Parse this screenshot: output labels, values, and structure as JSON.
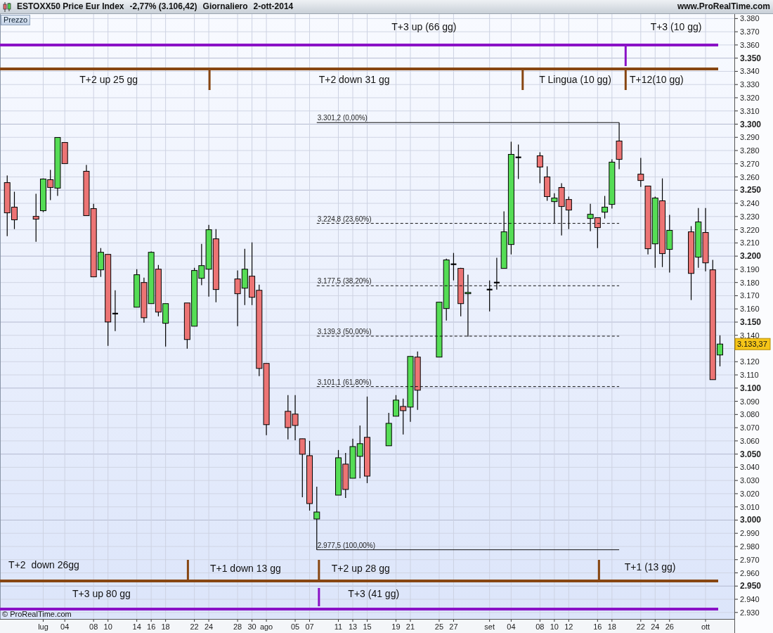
{
  "header": {
    "symbol": "ESTOXX50 Price Eur Index",
    "change": "-2,77% (3.106,42)",
    "period": "Giornaliero",
    "date": "2-ott-2014",
    "site": "www.ProRealTime.com"
  },
  "chart": {
    "pane_label": "Prezzo",
    "copyright": "© ProRealTime.com",
    "cycles": [
      {
        "color": "#8a12c6",
        "labels": [
          "T+3 up (66 gg)",
          "T+3 (10 gg)"
        ]
      },
      {
        "color": "#874612",
        "labels": [
          "T+2 up 25 gg",
          "T+2 down 31 gg",
          "T Lingua (10 gg)",
          "T+12(10 gg)"
        ]
      },
      {
        "color": "#874612",
        "labels": [
          "T+2  down 26gg",
          "T+1 down 13 gg",
          "T+2 up 28 gg",
          "T+1 (13 gg)"
        ]
      },
      {
        "color": "#8a12c6",
        "labels": [
          "T+3 up 80 gg",
          "T+3 (41 gg)"
        ]
      }
    ],
    "chart_data": {
      "type": "candlestick",
      "grid": true,
      "ylim": [
        2925.1,
        3383.4
      ],
      "xlim": [
        "2014-06-25",
        "2014-10-05"
      ],
      "x": [
        "2014-06-26",
        "2014-06-27",
        "2014-06-30",
        "2014-07-01",
        "2014-07-02",
        "2014-07-03",
        "2014-07-04",
        "2014-07-07",
        "2014-07-08",
        "2014-07-09",
        "2014-07-10",
        "2014-07-11",
        "2014-07-14",
        "2014-07-15",
        "2014-07-16",
        "2014-07-17",
        "2014-07-18",
        "2014-07-21",
        "2014-07-22",
        "2014-07-23",
        "2014-07-24",
        "2014-07-25",
        "2014-07-28",
        "2014-07-29",
        "2014-07-30",
        "2014-07-31",
        "2014-08-01",
        "2014-08-04",
        "2014-08-05",
        "2014-08-06",
        "2014-08-07",
        "2014-08-08",
        "2014-08-11",
        "2014-08-12",
        "2014-08-13",
        "2014-08-14",
        "2014-08-15",
        "2014-08-18",
        "2014-08-19",
        "2014-08-20",
        "2014-08-21",
        "2014-08-22",
        "2014-08-25",
        "2014-08-26",
        "2014-08-27",
        "2014-08-28",
        "2014-08-29",
        "2014-09-01",
        "2014-09-02",
        "2014-09-03",
        "2014-09-04",
        "2014-09-05",
        "2014-09-08",
        "2014-09-09",
        "2014-09-10",
        "2014-09-11",
        "2014-09-12",
        "2014-09-15",
        "2014-09-16",
        "2014-09-17",
        "2014-09-18",
        "2014-09-19",
        "2014-09-22",
        "2014-09-23",
        "2014-09-24",
        "2014-09-25",
        "2014-09-26",
        "2014-09-29",
        "2014-09-30",
        "2014-10-01",
        "2014-10-02",
        "2014-10-03"
      ],
      "ohlc": [
        [
          3255.7,
          3261.1,
          3215.2,
          3232.8
        ],
        [
          3237.1,
          3248.8,
          3220.5,
          3227.5
        ],
        [
          3230.1,
          3247.2,
          3210.9,
          3228.0
        ],
        [
          3234.4,
          3258.9,
          3233.3,
          3258.4
        ],
        [
          3257.9,
          3265.3,
          3242.4,
          3252.0
        ],
        [
          3251.5,
          3289.9,
          3245.6,
          3289.9
        ],
        [
          3286.1,
          3286.1,
          3270.1,
          3270.1
        ],
        [
          3264.3,
          3269.1,
          3230.7,
          3230.7
        ],
        [
          3236.0,
          3239.7,
          3184.3,
          3184.3
        ],
        [
          3189.6,
          3206.1,
          3184.3,
          3202.9
        ],
        [
          3201.3,
          3201.3,
          3132.0,
          3150.1
        ],
        [
          3156.5,
          3174.1,
          3143.2,
          3156.5
        ],
        [
          3161.3,
          3190.1,
          3161.3,
          3185.9
        ],
        [
          3180.0,
          3183.7,
          3149.6,
          3153.3
        ],
        [
          3164.0,
          3203.5,
          3164.0,
          3202.9
        ],
        [
          3190.1,
          3193.3,
          3154.4,
          3157.6
        ],
        [
          3149.1,
          3164.0,
          3131.5,
          3164.0
        ],
        [
          3164.5,
          3164.5,
          3129.9,
          3136.8
        ],
        [
          3146.9,
          3191.2,
          3146.9,
          3189.1
        ],
        [
          3183.2,
          3209.3,
          3177.9,
          3192.8
        ],
        [
          3190.1,
          3223.7,
          3169.3,
          3220.0
        ],
        [
          3213.1,
          3220.5,
          3165.1,
          3174.7
        ],
        [
          3182.7,
          3189.1,
          3146.9,
          3171.5
        ],
        [
          3175.7,
          3205.6,
          3162.9,
          3190.1
        ],
        [
          3184.8,
          3210.4,
          3162.9,
          3168.8
        ],
        [
          3174.1,
          3178.4,
          3109.1,
          3114.9
        ],
        [
          3118.7,
          3118.7,
          3064.3,
          3072.3
        ],
        [
          3082.4,
          3094.7,
          3061.1,
          3070.1
        ],
        [
          3080.3,
          3094.7,
          3060.5,
          3071.7
        ],
        [
          3061.6,
          3061.6,
          3017.3,
          3049.9
        ],
        [
          3048.8,
          3060.0,
          3007.2,
          3012.5
        ],
        [
          3000.8,
          3025.3,
          2977.5,
          3006.1
        ],
        [
          3018.9,
          3053.1,
          3018.9,
          3047.2
        ],
        [
          3042.4,
          3050.9,
          3016.8,
          3023.2
        ],
        [
          3031.7,
          3061.6,
          3031.7,
          3055.7
        ],
        [
          3048.3,
          3071.7,
          3031.7,
          3057.9
        ],
        [
          3062.7,
          3093.6,
          3028.0,
          3033.3
        ],
        [
          3056.3,
          3081.3,
          3056.3,
          3073.3
        ],
        [
          3078.7,
          3094.7,
          3078.7,
          3090.9
        ],
        [
          3086.1,
          3092.0,
          3064.8,
          3082.9
        ],
        [
          3085.6,
          3124.0,
          3074.4,
          3124.0
        ],
        [
          3123.5,
          3127.7,
          3083.5,
          3098.4
        ],
        [
          3123.5,
          3165.1,
          3123.5,
          3165.1
        ],
        [
          3160.3,
          3198.1,
          3151.2,
          3197.1
        ],
        [
          3193.9,
          3202.4,
          3181.6,
          3193.9
        ],
        [
          3190.7,
          3191.2,
          3154.4,
          3164.0
        ],
        [
          3171.5,
          3185.9,
          3138.9,
          3172.5
        ],
        [
          3174.7,
          3181.6,
          3158.1,
          3174.7
        ],
        [
          3180.0,
          3198.7,
          3174.7,
          3180.0
        ],
        [
          3190.7,
          3233.9,
          3190.7,
          3218.4
        ],
        [
          3208.8,
          3286.7,
          3201.3,
          3277.1
        ],
        [
          3274.9,
          3284.5,
          3258.4,
          3274.9
        ],
        [
          3276.0,
          3278.7,
          3255.2,
          3267.5
        ],
        [
          3260.0,
          3268.0,
          3241.9,
          3245.1
        ],
        [
          3241.3,
          3247.7,
          3224.8,
          3244.0
        ],
        [
          3252.0,
          3255.2,
          3215.7,
          3237.6
        ],
        [
          3242.9,
          3245.1,
          3220.5,
          3234.9
        ],
        [
          3228.5,
          3239.7,
          3218.9,
          3231.7
        ],
        [
          3229.1,
          3229.1,
          3206.1,
          3221.6
        ],
        [
          3233.3,
          3245.6,
          3228.5,
          3237.1
        ],
        [
          3239.2,
          3273.3,
          3236.0,
          3271.2
        ],
        [
          3287.2,
          3301.2,
          3265.9,
          3273.3
        ],
        [
          3262.1,
          3274.4,
          3252.5,
          3257.3
        ],
        [
          3253.1,
          3253.1,
          3201.3,
          3205.6
        ],
        [
          3209.3,
          3245.1,
          3191.2,
          3244.0
        ],
        [
          3241.9,
          3258.9,
          3191.7,
          3201.9
        ],
        [
          3205.1,
          3231.2,
          3187.5,
          3219.5
        ],
        [
          3218.4,
          3222.7,
          3166.7,
          3186.9
        ],
        [
          3199.2,
          3236.5,
          3191.2,
          3225.9
        ],
        [
          3217.9,
          3236.5,
          3188.5,
          3194.9
        ],
        [
          3189.6,
          3197.1,
          3106.4,
          3106.4
        ],
        [
          3125.1,
          3140.0,
          3116.5,
          3133.37
        ]
      ],
      "xticks": [
        {
          "value": "2014-07-01",
          "label": "lug"
        },
        {
          "value": "2014-07-04",
          "label": "04"
        },
        {
          "value": "2014-07-08",
          "label": "08"
        },
        {
          "value": "2014-07-10",
          "label": "10"
        },
        {
          "value": "2014-07-14",
          "label": "14"
        },
        {
          "value": "2014-07-16",
          "label": "16"
        },
        {
          "value": "2014-07-18",
          "label": "18"
        },
        {
          "value": "2014-07-22",
          "label": "22"
        },
        {
          "value": "2014-07-24",
          "label": "24"
        },
        {
          "value": "2014-07-28",
          "label": "28"
        },
        {
          "value": "2014-07-30",
          "label": "30"
        },
        {
          "value": "2014-08-01",
          "label": "ago"
        },
        {
          "value": "2014-08-05",
          "label": "05"
        },
        {
          "value": "2014-08-07",
          "label": "07"
        },
        {
          "value": "2014-08-11",
          "label": "11"
        },
        {
          "value": "2014-08-13",
          "label": "13"
        },
        {
          "value": "2014-08-15",
          "label": "15"
        },
        {
          "value": "2014-08-19",
          "label": "19"
        },
        {
          "value": "2014-08-21",
          "label": "21"
        },
        {
          "value": "2014-08-25",
          "label": "25"
        },
        {
          "value": "2014-08-27",
          "label": "27"
        },
        {
          "value": "2014-09-01",
          "label": "set"
        },
        {
          "value": "2014-09-04",
          "label": "04"
        },
        {
          "value": "2014-09-08",
          "label": "08"
        },
        {
          "value": "2014-09-10",
          "label": "10"
        },
        {
          "value": "2014-09-12",
          "label": "12"
        },
        {
          "value": "2014-09-16",
          "label": "16"
        },
        {
          "value": "2014-09-18",
          "label": "18"
        },
        {
          "value": "2014-09-22",
          "label": "22"
        },
        {
          "value": "2014-09-24",
          "label": "24"
        },
        {
          "value": "2014-09-26",
          "label": "26"
        },
        {
          "value": "2014-10-01",
          "label": "ott"
        }
      ],
      "yticks": [
        {
          "value": 3380,
          "label": "3.380"
        },
        {
          "value": 3370,
          "label": "3.370"
        },
        {
          "value": 3360,
          "label": "3.360"
        },
        {
          "value": 3350,
          "label": "3.350"
        },
        {
          "value": 3340,
          "label": "3.340"
        },
        {
          "value": 3330,
          "label": "3.330"
        },
        {
          "value": 3320,
          "label": "3.320"
        },
        {
          "value": 3310,
          "label": "3.310"
        },
        {
          "value": 3300,
          "label": "3.300"
        },
        {
          "value": 3290,
          "label": "3.290"
        },
        {
          "value": 3280,
          "label": "3.280"
        },
        {
          "value": 3270,
          "label": "3.270"
        },
        {
          "value": 3260,
          "label": "3.260"
        },
        {
          "value": 3250,
          "label": "3.250"
        },
        {
          "value": 3240,
          "label": "3.240"
        },
        {
          "value": 3230,
          "label": "3.230"
        },
        {
          "value": 3220,
          "label": "3.220"
        },
        {
          "value": 3210,
          "label": "3.210"
        },
        {
          "value": 3200,
          "label": "3.200"
        },
        {
          "value": 3190,
          "label": "3.190"
        },
        {
          "value": 3180,
          "label": "3.180"
        },
        {
          "value": 3170,
          "label": "3.170"
        },
        {
          "value": 3160,
          "label": "3.160"
        },
        {
          "value": 3150,
          "label": "3.150"
        },
        {
          "value": 3140,
          "label": "3.140"
        },
        {
          "value": 3120,
          "label": "3.120"
        },
        {
          "value": 3110,
          "label": "3.110"
        },
        {
          "value": 3100,
          "label": "3.100"
        },
        {
          "value": 3090,
          "label": "3.090"
        },
        {
          "value": 3080,
          "label": "3.080"
        },
        {
          "value": 3070,
          "label": "3.070"
        },
        {
          "value": 3060,
          "label": "3.060"
        },
        {
          "value": 3050,
          "label": "3.050"
        },
        {
          "value": 3040,
          "label": "3.040"
        },
        {
          "value": 3030,
          "label": "3.030"
        },
        {
          "value": 3020,
          "label": "3.020"
        },
        {
          "value": 3010,
          "label": "3.010"
        },
        {
          "value": 3000,
          "label": "3.000"
        },
        {
          "value": 2990,
          "label": "2.990"
        },
        {
          "value": 2980,
          "label": "2.980"
        },
        {
          "value": 2970,
          "label": "2.970"
        },
        {
          "value": 2960,
          "label": "2.960"
        },
        {
          "value": 2950,
          "label": "2.950"
        },
        {
          "value": 2940,
          "label": "2.940"
        },
        {
          "value": 2930,
          "label": "2.930"
        }
      ],
      "annotations": [
        "3.301,2 (0,00%)",
        "3.224,8 (23,60%)",
        "3.177,5 (38,20%)",
        "3.139,3 (50,00%)",
        "3.101,1 (61,80%)",
        "2.977,5 (100,00%)",
        "3.133,37"
      ]
    }
  }
}
